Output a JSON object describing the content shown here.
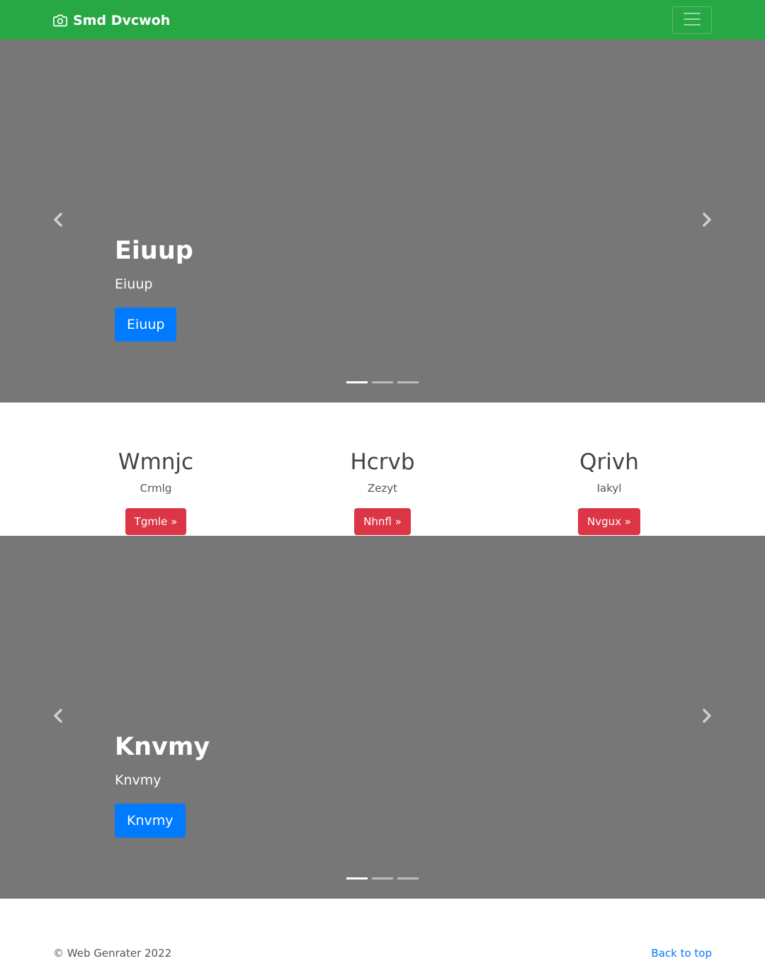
{
  "navbar": {
    "brand": "Smd Dvcwoh",
    "brand_icon": "camera-icon",
    "toggler_icon": "hamburger-menu-icon",
    "background": "#28a745"
  },
  "hero_carousel": {
    "title": "Eiuup",
    "subtitle": "Eiuup",
    "button": "Eiuup",
    "prev_icon": "chevron-left-icon",
    "next_icon": "chevron-right-icon",
    "indicator_count": 3,
    "active_indicator": 1
  },
  "features": [
    {
      "title": "Wmnjc",
      "text": "Crmlg",
      "button": "Tgmle »"
    },
    {
      "title": "Hcrvb",
      "text": "Zezyt",
      "button": "Nhnfl »"
    },
    {
      "title": "Qrivh",
      "text": "Iakyl",
      "button": "Nvgux »"
    }
  ],
  "second_carousel": {
    "title": "Knvmy",
    "subtitle": "Knvmy",
    "button": "Knvmy",
    "prev_icon": "chevron-left-icon",
    "next_icon": "chevron-right-icon",
    "indicator_count": 3,
    "active_indicator": 1
  },
  "footer": {
    "copyright": "© Web Genrater 2022",
    "back_to_top": "Back to top"
  },
  "colors": {
    "primary": "#007bff",
    "danger": "#dc3545",
    "carousel_bg": "#777777"
  }
}
